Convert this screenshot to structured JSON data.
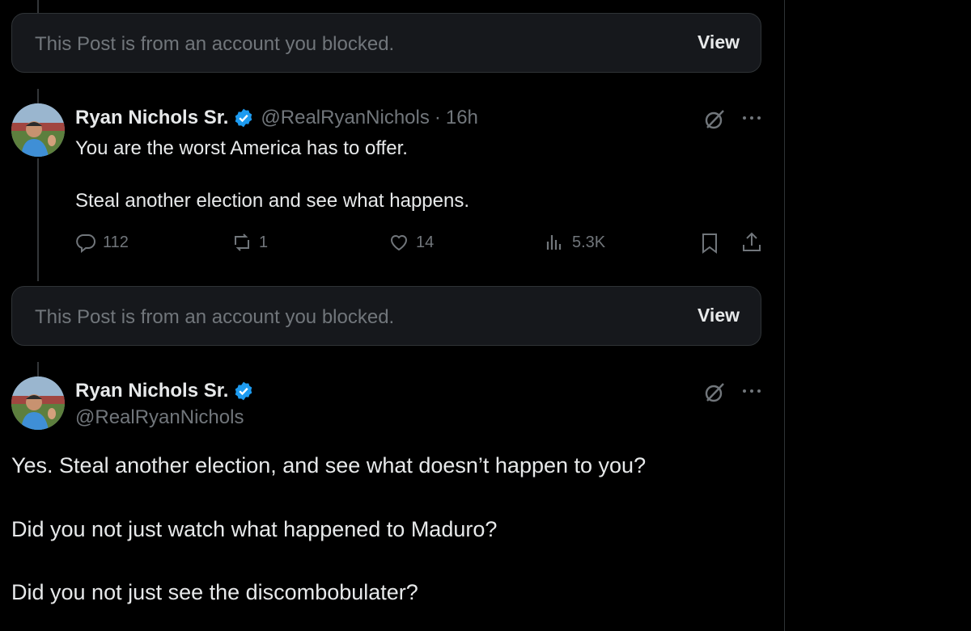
{
  "blocked_notice": {
    "text": "This Post is from an account you blocked.",
    "view_label": "View"
  },
  "reply": {
    "display_name": "Ryan Nichols Sr.",
    "handle": "@RealRyanNichols",
    "separator": "·",
    "time": "16h",
    "text_line1": "You are the worst America has to offer.",
    "text_line2": "Steal another election and see what happens.",
    "replies": "112",
    "reposts": "1",
    "likes": "14",
    "views": "5.3K"
  },
  "main_post": {
    "display_name": "Ryan Nichols Sr.",
    "handle": "@RealRyanNichols",
    "line1": "Yes. Steal another election, and see what doesn’t happen to you?",
    "line2": "Did you not just watch what happened to Maduro?",
    "line3": "Did you not just see the discombobulater?"
  },
  "colors": {
    "background": "#000000",
    "text": "#e7e9ea",
    "muted": "#71767b",
    "verified": "#1d9bf0",
    "blocked_box": "#16181c"
  },
  "icons": [
    "verified-badge-icon",
    "grok-icon",
    "more-icon",
    "reply-icon",
    "repost-icon",
    "like-icon",
    "views-icon",
    "bookmark-icon",
    "share-icon"
  ]
}
